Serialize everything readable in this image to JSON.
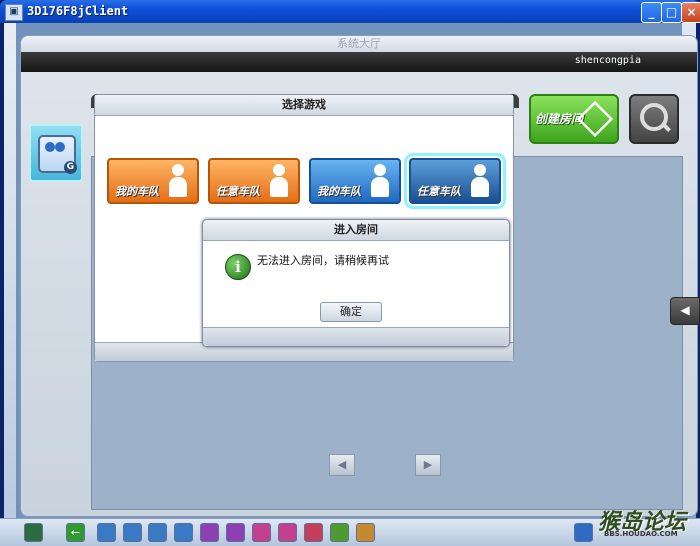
{
  "window": {
    "title": "3D176F8jClient",
    "minimize_label": "_",
    "maximize_label": "□",
    "close_label": "×",
    "icon": "app-icon"
  },
  "app": {
    "top_title": "系统大厅",
    "username": "shencongpia",
    "create_room_label": "创建房间",
    "mode_icon": "team-mode-icon"
  },
  "select_dialog": {
    "title": "选择游戏",
    "options": [
      {
        "label": "我的车队",
        "color": "orange"
      },
      {
        "label": "任意车队",
        "color": "orange"
      },
      {
        "label": "我的车队",
        "color": "blue"
      },
      {
        "label": "任意车队",
        "color": "blue",
        "selected": true
      }
    ]
  },
  "room_dialog": {
    "title": "进入房间",
    "message": "无法进入房间，请稍候再试",
    "ok_label": "确定",
    "icon": "info-icon"
  },
  "nav": {
    "prev_label": "◀",
    "next_label": "▶",
    "side_tab_label": "◀"
  },
  "watermark": {
    "text": "猴岛论坛",
    "url": "BBS.HOUDAO.COM"
  },
  "colors": {
    "title_bar": "#0b4ed8",
    "orange_team": "#e46e16",
    "blue_team": "#1f69c2",
    "create_green": "#3da51d"
  }
}
